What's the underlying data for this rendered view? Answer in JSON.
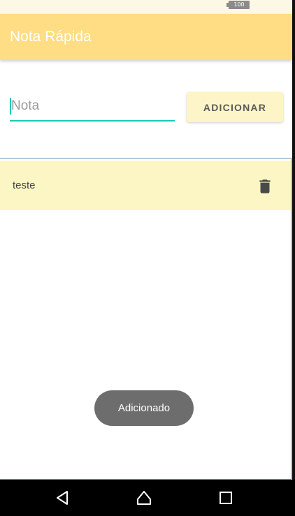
{
  "status_bar": {
    "battery": "100"
  },
  "app_bar": {
    "title": "Nota Rápida"
  },
  "form": {
    "input_value": "",
    "input_placeholder": "Nota",
    "add_label": "ADICIONAR"
  },
  "notes": [
    {
      "text": "teste"
    }
  ],
  "toast": {
    "message": "Adicionado"
  },
  "icons": {
    "delete": "trash-icon",
    "back": "back-triangle-icon",
    "home": "home-icon",
    "recents": "recents-square-icon"
  },
  "colors": {
    "app_bar": "#fedd84",
    "accent": "#18c9b3",
    "list_item": "#fcf6c5",
    "button": "#fdf5c7",
    "toast": "#6d6d6d"
  }
}
